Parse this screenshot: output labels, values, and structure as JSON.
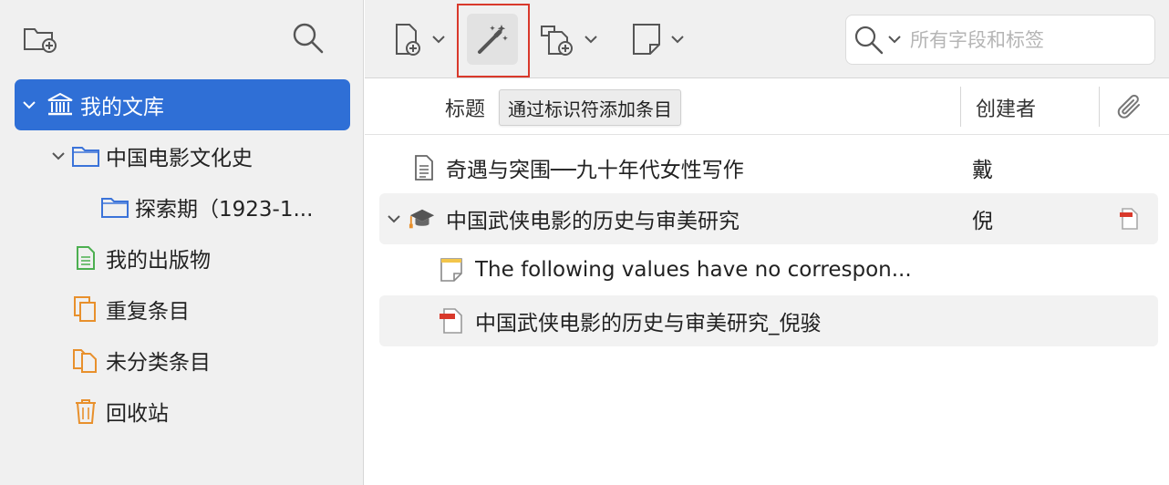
{
  "sidebar": {
    "tree": [
      {
        "label": "我的文库",
        "icon": "library-icon",
        "expanded": true,
        "selected": true
      },
      {
        "label": "中国电影文化史",
        "icon": "folder-icon",
        "expanded": true
      },
      {
        "label": "探索期（1923-1...",
        "icon": "folder-icon"
      },
      {
        "label": "我的出版物",
        "icon": "publications-icon"
      },
      {
        "label": "重复条目",
        "icon": "duplicates-icon"
      },
      {
        "label": "未分类条目",
        "icon": "unfiled-icon"
      },
      {
        "label": "回收站",
        "icon": "trash-icon"
      }
    ]
  },
  "toolbar": {
    "tooltip": "通过标识符添加条目"
  },
  "search": {
    "placeholder": "所有字段和标签",
    "value": ""
  },
  "columns": {
    "title": "标题",
    "creator": "创建者"
  },
  "items": [
    {
      "title": "奇遇与突围──九十年代女性写作",
      "creator": "戴",
      "icon": "document-icon"
    },
    {
      "title": "中国武侠电影的历史与审美研究",
      "creator": "倪",
      "icon": "thesis-icon",
      "expanded": true,
      "attachment": "pdf-icon"
    },
    {
      "title": "The following values have no correspon...",
      "creator": "",
      "icon": "note-icon",
      "child": true
    },
    {
      "title": "中国武侠电影的历史与审美研究_倪骏",
      "creator": "",
      "icon": "pdf-icon",
      "child": true
    }
  ],
  "colors": {
    "selection": "#2f6fd6",
    "highlight_frame": "#d9392b",
    "icon_blue": "#3b73d9",
    "icon_green": "#4caf50",
    "icon_orange": "#e8902c"
  }
}
